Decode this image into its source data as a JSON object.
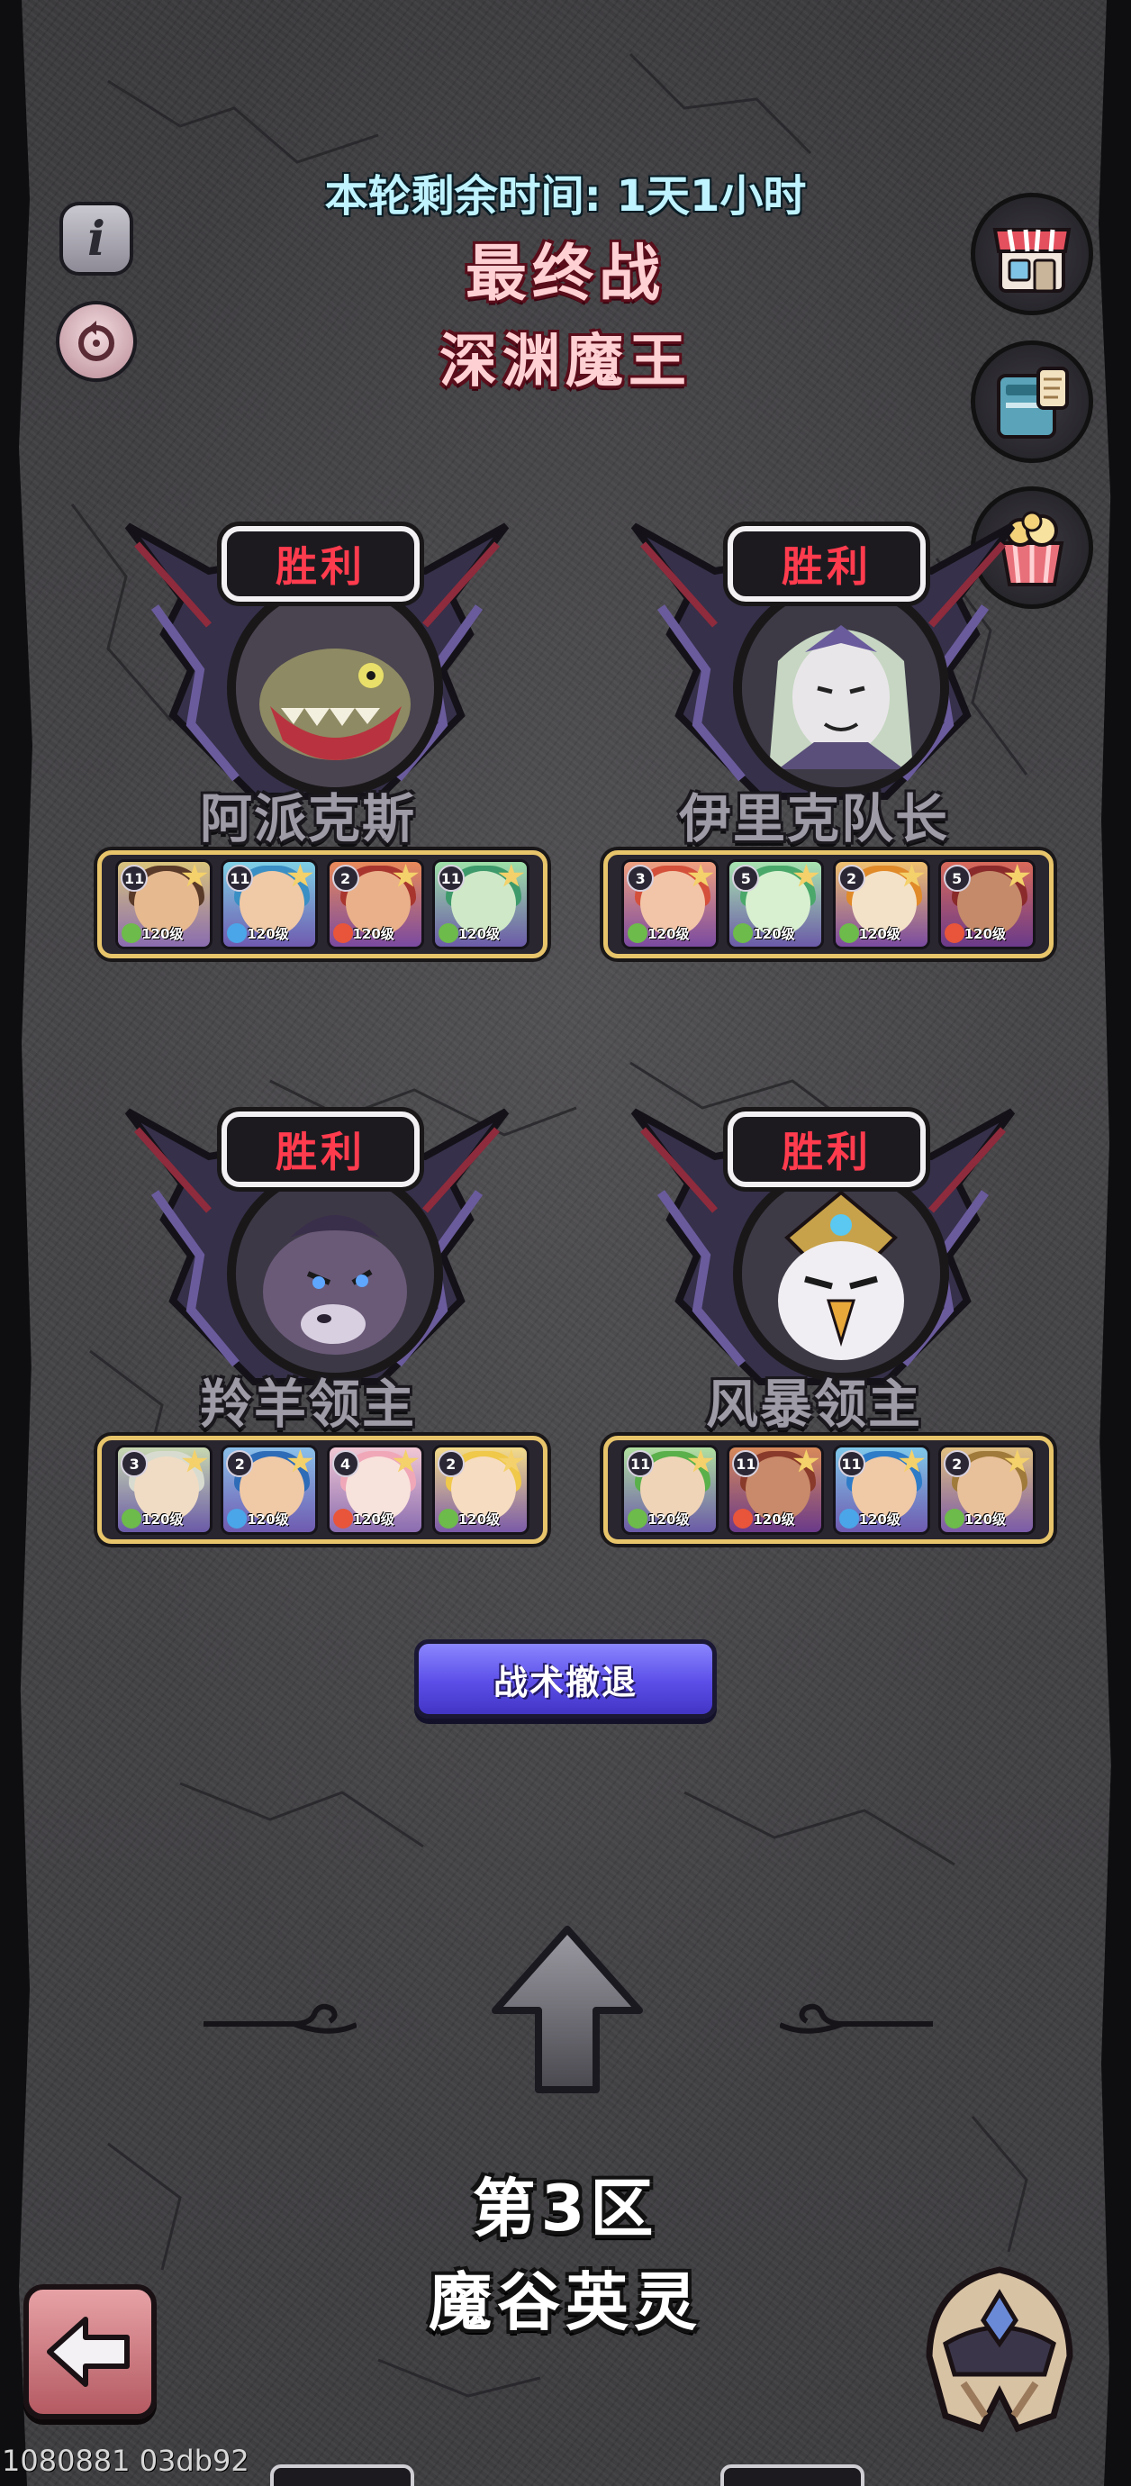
{
  "header": {
    "timer_text": "本轮剩余时间: 1天1小时",
    "title": "最终战",
    "subtitle": "深渊魔王"
  },
  "side_buttons": {
    "info_icon": "info-icon",
    "replay_icon": "replay-icon",
    "shop_icon": "shop-icon",
    "book_icon": "book-icon",
    "gift_icon": "gift-bag-icon"
  },
  "bosses": [
    {
      "status": "胜利",
      "name": "阿派克斯",
      "heroes": [
        {
          "rank": "11",
          "level": "120级"
        },
        {
          "rank": "11",
          "level": "120级"
        },
        {
          "rank": "2",
          "level": "120级"
        },
        {
          "rank": "11",
          "level": "120级"
        }
      ]
    },
    {
      "status": "胜利",
      "name": "伊里克队长",
      "heroes": [
        {
          "rank": "3",
          "level": "120级"
        },
        {
          "rank": "5",
          "level": "120级"
        },
        {
          "rank": "2",
          "level": "120级"
        },
        {
          "rank": "5",
          "level": "120级"
        }
      ]
    },
    {
      "status": "胜利",
      "name": "羚羊领主",
      "heroes": [
        {
          "rank": "3",
          "level": "120级"
        },
        {
          "rank": "2",
          "level": "120级"
        },
        {
          "rank": "4",
          "level": "120级"
        },
        {
          "rank": "2",
          "level": "120级"
        }
      ]
    },
    {
      "status": "胜利",
      "name": "风暴领主",
      "heroes": [
        {
          "rank": "11",
          "level": "120级"
        },
        {
          "rank": "11",
          "level": "120级"
        },
        {
          "rank": "11",
          "level": "120级"
        },
        {
          "rank": "2",
          "level": "120级"
        }
      ]
    }
  ],
  "retreat_button": "战术撤退",
  "zone": {
    "number": "第3区",
    "name": "魔谷英灵"
  },
  "build_id": "1080881 03db92",
  "colors": {
    "victory_red": "#ff3b4e",
    "timer_cyan": "#bff3ff",
    "title_pink": "#ffd0d3",
    "retreat_purple": "#5b4ee8",
    "team_gold": "#e8c56b"
  }
}
